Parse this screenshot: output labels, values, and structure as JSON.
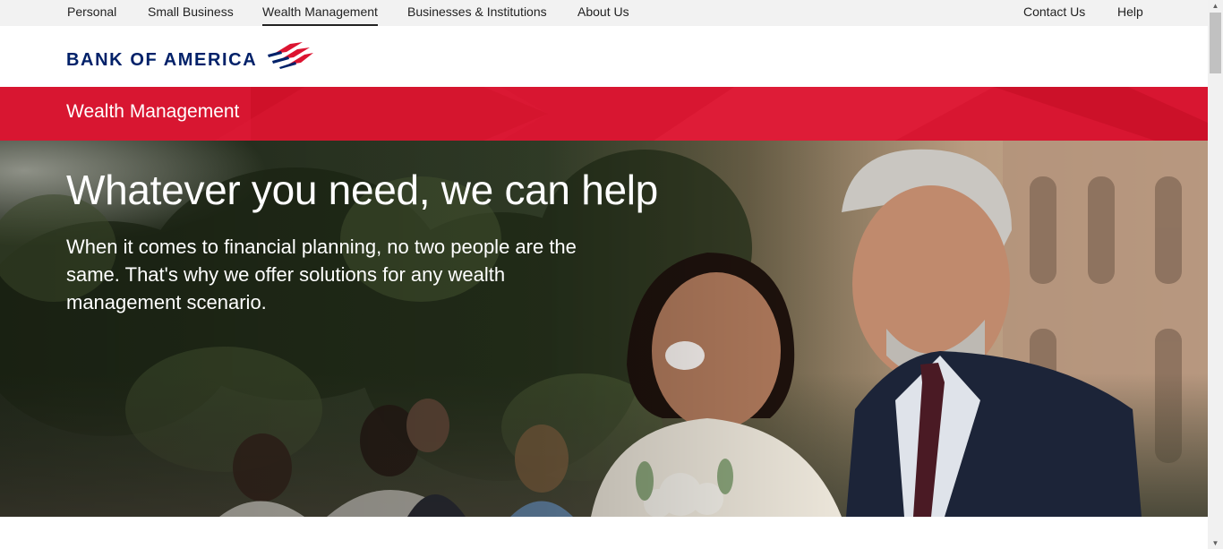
{
  "top_nav": {
    "items": [
      "Personal",
      "Small Business",
      "Wealth Management",
      "Businesses & Institutions",
      "About Us"
    ],
    "active": "Wealth Management",
    "utility": [
      "Contact Us",
      "Help"
    ]
  },
  "brand": {
    "name": "BANK OF AMERICA",
    "logo_icon": "flag-logo-icon",
    "colors": {
      "navy": "#012169",
      "red": "#dc1431"
    }
  },
  "section": {
    "title": "Wealth Management"
  },
  "hero": {
    "heading": "Whatever you need, we can help",
    "body": "When it comes to financial planning, no two people are the same. That's why we offer solutions for any wealth management scenario."
  }
}
